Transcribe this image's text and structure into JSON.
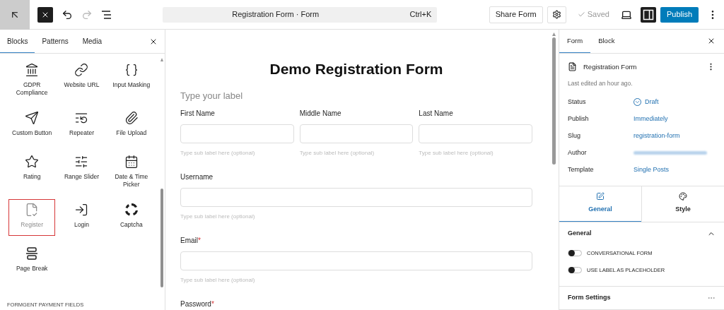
{
  "toolbar": {
    "redo_disabled": true,
    "command_bar": {
      "title": "Registration Form · Form",
      "shortcut": "Ctrl+K"
    },
    "share_button": "Share Form",
    "saved_label": "Saved",
    "sidebar_toggle_on": true,
    "publish_button": "Publish"
  },
  "inserter": {
    "tabs": [
      {
        "label": "Blocks",
        "selected": true
      },
      {
        "label": "Patterns",
        "selected": false
      },
      {
        "label": "Media",
        "selected": false
      }
    ],
    "blocks": [
      {
        "kind": "bank",
        "label": "GDPR Compliance",
        "selected": false
      },
      {
        "kind": "link",
        "label": "Website URL",
        "selected": false
      },
      {
        "kind": "braces",
        "label": "Input Masking",
        "selected": false
      },
      {
        "kind": "send",
        "label": "Custom Button",
        "selected": false
      },
      {
        "kind": "repeater",
        "label": "Repeater",
        "selected": false
      },
      {
        "kind": "paperclip",
        "label": "File Upload",
        "selected": false
      },
      {
        "kind": "star",
        "label": "Rating",
        "selected": false
      },
      {
        "kind": "sliders",
        "label": "Range Slider",
        "selected": false
      },
      {
        "kind": "calendar",
        "label": "Date & Time Picker",
        "selected": false
      },
      {
        "kind": "register",
        "label": "Register",
        "selected": true
      },
      {
        "kind": "login",
        "label": "Login",
        "selected": false
      },
      {
        "kind": "captcha",
        "label": "Captcha",
        "selected": false
      },
      {
        "kind": "pagebreak",
        "label": "Page Break",
        "selected": false
      }
    ],
    "section_heading": "FORMGENT PAYMENT FIELDS"
  },
  "canvas": {
    "title": "Demo Registration Form",
    "group_label": "Type your label",
    "name_fields": [
      {
        "label": "First Name",
        "sublabel": "Type sub label here (optional)"
      },
      {
        "label": "Middle Name",
        "sublabel": "Type sub label here (optional)"
      },
      {
        "label": "Last Name",
        "sublabel": "Type sub label here (optional)"
      }
    ],
    "fields": [
      {
        "label": "Username",
        "sublabel": "Type sub label here (optional)"
      },
      {
        "label": "Email",
        "required_mark": "*",
        "sublabel": "Type sub label here (optional)"
      }
    ],
    "cut_field": {
      "label": "Password",
      "required_mark": "*"
    }
  },
  "settings": {
    "tabs": [
      {
        "label": "Form",
        "selected": true
      },
      {
        "label": "Block",
        "selected": false
      }
    ],
    "document_title": "Registration Form",
    "last_edited": "Last edited an hour ago.",
    "rows": [
      {
        "label": "Status",
        "value": "Draft",
        "kind": "status"
      },
      {
        "label": "Publish",
        "value": "Immediately",
        "kind": "link"
      },
      {
        "label": "Slug",
        "value": "registration-form",
        "kind": "link"
      },
      {
        "label": "Author",
        "kind": "blurred"
      },
      {
        "label": "Template",
        "value": "Single Posts",
        "kind": "link"
      }
    ],
    "panel_tabs": [
      {
        "label": "General",
        "selected": true,
        "kind": "edit"
      },
      {
        "label": "Style",
        "selected": false,
        "kind": "palette"
      }
    ],
    "general": {
      "title": "General",
      "expanded": true,
      "toggles": [
        {
          "label": "CONVERSATIONAL FORM",
          "on": false
        },
        {
          "label": "USE LABEL AS PLACEHOLDER",
          "on": false
        }
      ]
    },
    "form_settings": "Form Settings"
  }
}
